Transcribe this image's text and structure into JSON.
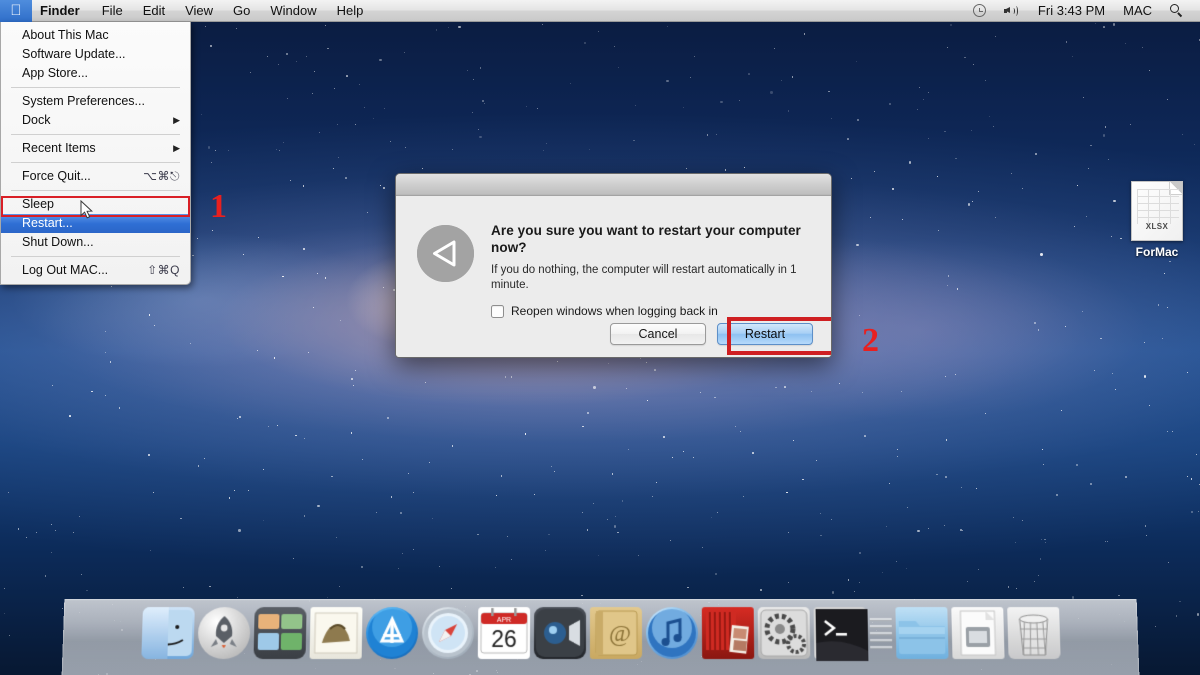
{
  "menubar": {
    "apple_icon": "apple-logo-icon",
    "items": [
      {
        "label": "Finder",
        "bold": true
      },
      {
        "label": "File",
        "bold": false
      },
      {
        "label": "Edit",
        "bold": false
      },
      {
        "label": "View",
        "bold": false
      },
      {
        "label": "Go",
        "bold": false
      },
      {
        "label": "Window",
        "bold": false
      },
      {
        "label": "Help",
        "bold": false
      }
    ],
    "status": {
      "timemachine_icon": "time-machine-icon",
      "volume_icon": "volume-speaker-icon",
      "clock": "Fri 3:43 PM",
      "user": "MAC",
      "search_icon": "spotlight-search-icon"
    }
  },
  "apple_menu": {
    "groups": [
      [
        {
          "label": "About This Mac",
          "shortcut": "",
          "arrow": false,
          "selected": false
        },
        {
          "label": "Software Update...",
          "shortcut": "",
          "arrow": false,
          "selected": false
        },
        {
          "label": "App Store...",
          "shortcut": "",
          "arrow": false,
          "selected": false
        }
      ],
      [
        {
          "label": "System Preferences...",
          "shortcut": "",
          "arrow": false,
          "selected": false
        },
        {
          "label": "Dock",
          "shortcut": "",
          "arrow": true,
          "selected": false
        }
      ],
      [
        {
          "label": "Recent Items",
          "shortcut": "",
          "arrow": true,
          "selected": false
        }
      ],
      [
        {
          "label": "Force Quit...",
          "shortcut": "⌥⌘⎋",
          "arrow": false,
          "selected": false
        }
      ],
      [
        {
          "label": "Sleep",
          "shortcut": "",
          "arrow": false,
          "selected": false
        },
        {
          "label": "Restart...",
          "shortcut": "",
          "arrow": false,
          "selected": true
        },
        {
          "label": "Shut Down...",
          "shortcut": "",
          "arrow": false,
          "selected": false
        }
      ],
      [
        {
          "label": "Log Out MAC...",
          "shortcut": "⇧⌘Q",
          "arrow": false,
          "selected": false
        }
      ]
    ]
  },
  "dialog": {
    "icon": "restart-arrow-icon",
    "heading": "Are you sure you want to restart your computer now?",
    "subtext": "If you do nothing, the computer will restart automatically in 1 minute.",
    "checkbox": {
      "label": "Reopen windows when logging back in",
      "checked": false
    },
    "buttons": {
      "cancel_label": "Cancel",
      "restart_label": "Restart"
    }
  },
  "annotations": [
    {
      "id": "step-1",
      "text": "1",
      "color": "#e8201f"
    },
    {
      "id": "step-2",
      "text": "2",
      "color": "#e8201f"
    }
  ],
  "highlight_color": "#cf1f22",
  "desktop_icon": {
    "extension_label": "XLSX",
    "name": "ForMac"
  },
  "dock": {
    "items": [
      {
        "name": "finder",
        "label": "Finder"
      },
      {
        "name": "launchpad",
        "label": "Launchpad"
      },
      {
        "name": "mission-control",
        "label": "Mission Control"
      },
      {
        "name": "mail",
        "label": "Mail"
      },
      {
        "name": "app-store",
        "label": "App Store"
      },
      {
        "name": "safari",
        "label": "Safari"
      },
      {
        "name": "calendar",
        "label": "Calendar"
      },
      {
        "name": "facetime",
        "label": "FaceTime"
      },
      {
        "name": "contacts",
        "label": "Contacts"
      },
      {
        "name": "itunes",
        "label": "iTunes"
      },
      {
        "name": "iphoto",
        "label": "iPhoto"
      },
      {
        "name": "system-preferences",
        "label": "System Preferences"
      },
      {
        "name": "terminal",
        "label": "Terminal"
      },
      {
        "name": "documents-folder",
        "label": "Documents"
      },
      {
        "name": "downloads-stack",
        "label": "Downloads"
      },
      {
        "name": "trash",
        "label": "Trash"
      }
    ],
    "calendar": {
      "month": "APR",
      "day": "26"
    }
  }
}
